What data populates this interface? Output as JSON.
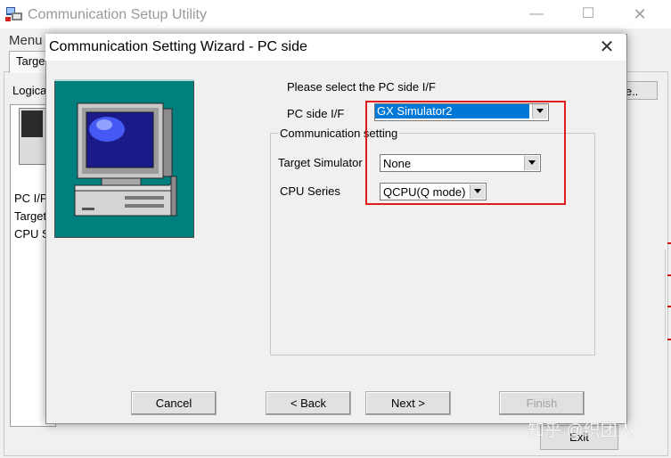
{
  "background_window": {
    "title": "Communication Setup Utility",
    "menu": "Menu",
    "tab": "Targe",
    "section_label": "Logica",
    "field_labels": [
      "PC I/F",
      "Target",
      "CPU S"
    ],
    "right_button": "ete..",
    "exit_button": "Exit",
    "icons": {
      "app": "app-icon",
      "minimize": "minimize-icon",
      "maximize": "maximize-icon",
      "close": "close-icon"
    }
  },
  "dialog": {
    "title": "Communication Setting Wizard - PC side",
    "close_icon": "close-icon",
    "prompt": "Please select the PC side I/F",
    "pc_side_if": {
      "label": "PC side I/F",
      "value": "GX Simulator2"
    },
    "group_title": "Communication setting",
    "target_simulator": {
      "label": "Target Simulator",
      "value": "None"
    },
    "cpu_series": {
      "label": "CPU Series",
      "value": "QCPU(Q mode)"
    },
    "buttons": {
      "cancel": "Cancel",
      "back": "< Back",
      "next": "Next >",
      "finish": "Finish"
    },
    "illustration": "computer-icon",
    "colors": {
      "illustration_bg": "#007f7f",
      "selection": "#0078d7",
      "highlight_annotation": "#e01b1b"
    }
  },
  "watermark": "知乎 @织团人"
}
